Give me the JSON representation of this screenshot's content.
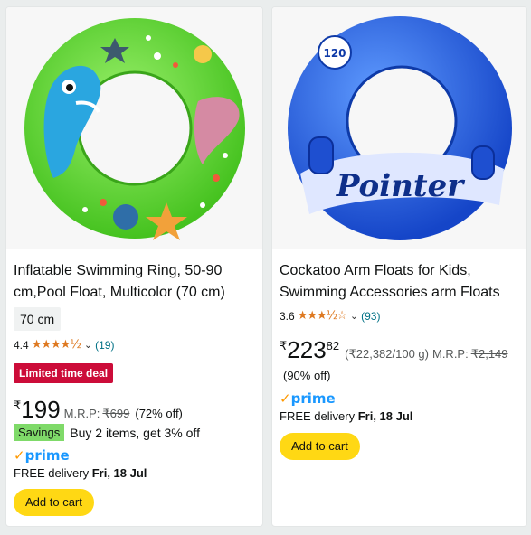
{
  "products": [
    {
      "title": "Inflatable Swimming Ring, 50-90 cm,Pool Float, Multicolor (70 cm)",
      "size_chip": "70 cm",
      "rating": "4.4",
      "stars": "★★★★½",
      "review_count": "(19)",
      "deal_badge": "Limited time deal",
      "price_symbol": "₹",
      "price_whole": "199",
      "mrp_label": "M.R.P:",
      "mrp_value": "₹699",
      "discount": "(72% off)",
      "savings_badge": "Savings",
      "savings_text": "Buy 2 items, get 3% off",
      "prime_check": "✓",
      "prime_label": "prime",
      "delivery_prefix": "FREE delivery",
      "delivery_date": "Fri, 18 Jul",
      "cart_label": "Add to cart"
    },
    {
      "title": "Cockatoo Arm Floats for Kids, Swimming Accessories arm Floats",
      "rating": "3.6",
      "stars": "★★★½☆",
      "review_count": "(93)",
      "price_symbol": "₹",
      "price_whole": "223",
      "price_fraction": "82",
      "unit_price": "(₹22,382/100 g)",
      "mrp_label": "M.R.P:",
      "mrp_value": "₹2,149",
      "discount": "(90% off)",
      "prime_check": "✓",
      "prime_label": "prime",
      "delivery_prefix": "FREE delivery",
      "delivery_date": "Fri, 18 Jul",
      "cart_label": "Add to cart",
      "image_text": {
        "badge": "120",
        "brand": "Pointer"
      }
    }
  ],
  "colors": {
    "ring_green": "#5fd23c",
    "ring_blue": "#2563e0",
    "star": "#de7921",
    "prime_blue": "#1a98ff",
    "deal_red": "#cc0c39",
    "savings_green": "#7fda69",
    "cart_yellow": "#ffd814"
  }
}
